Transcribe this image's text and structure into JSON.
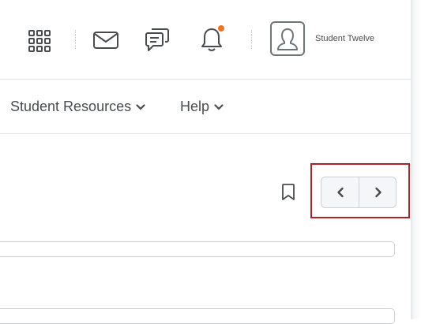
{
  "header": {
    "user_name": "Student Twelve",
    "notification_badge_color": "#f2731f",
    "icons": [
      "app-launcher-icon",
      "email-icon",
      "chat-icon",
      "bell-icon",
      "user-avatar-icon"
    ]
  },
  "nav": {
    "items": [
      {
        "label": "Student Resources",
        "has_dropdown": true
      },
      {
        "label": "Help",
        "has_dropdown": true
      }
    ]
  },
  "toolbar": {
    "icons": [
      "bookmark-icon",
      "chevron-left-icon",
      "chevron-right-icon"
    ],
    "highlight_color": "#b32025"
  }
}
